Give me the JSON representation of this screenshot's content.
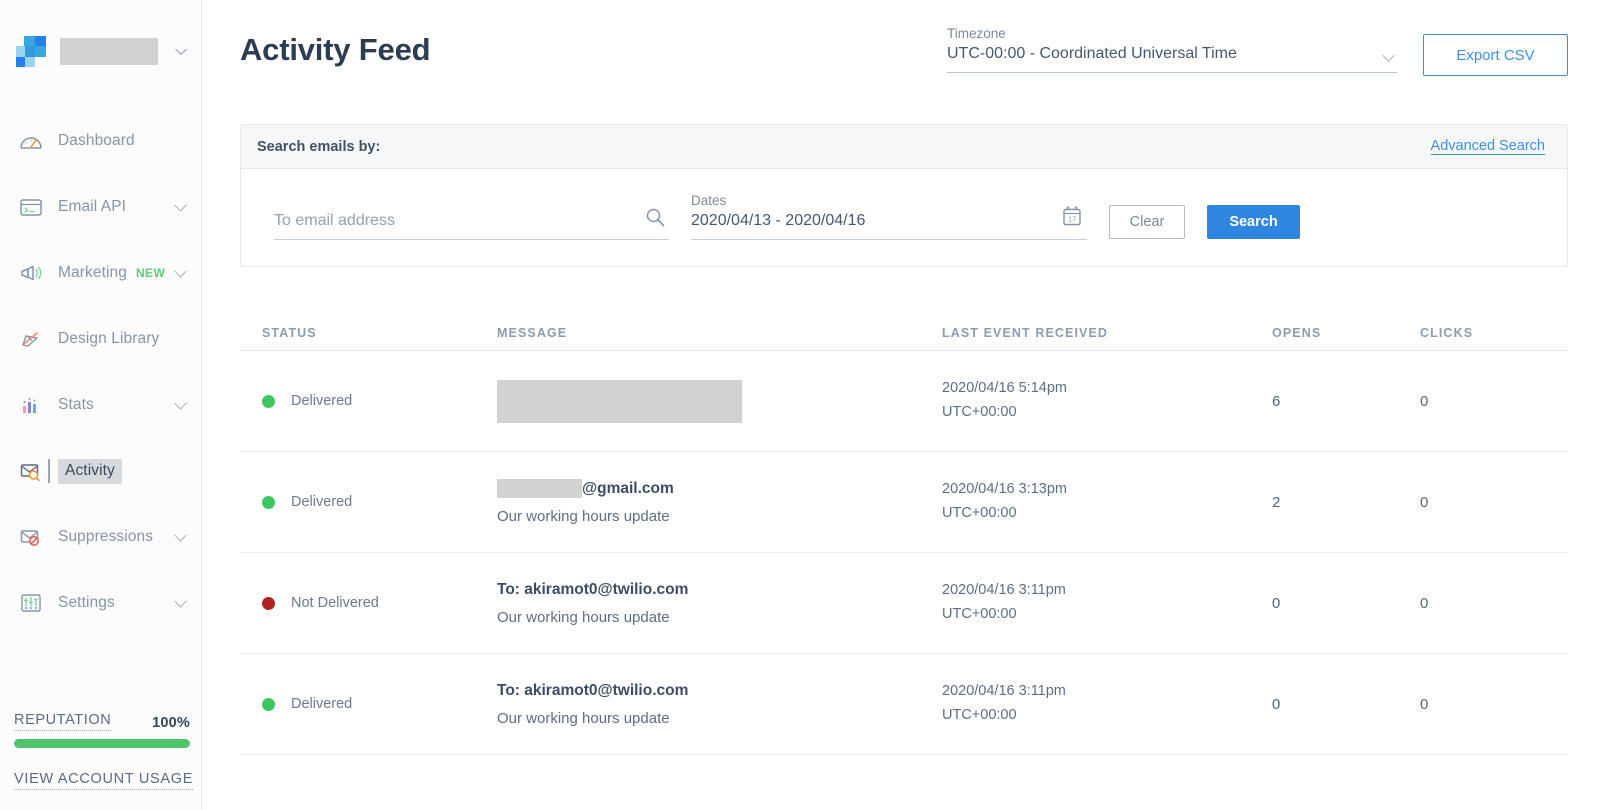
{
  "sidebar": {
    "account_redacted": true,
    "items": [
      {
        "label": "Dashboard",
        "icon": "gauge-icon",
        "caret": false,
        "active": false,
        "badge": null
      },
      {
        "label": "Email API",
        "icon": "terminal-icon",
        "caret": true,
        "active": false,
        "badge": null
      },
      {
        "label": "Marketing",
        "icon": "megaphone-icon",
        "caret": true,
        "active": false,
        "badge": "NEW"
      },
      {
        "label": "Design Library",
        "icon": "pencil-ruler-icon",
        "caret": false,
        "active": false,
        "badge": null
      },
      {
        "label": "Stats",
        "icon": "bar-chart-icon",
        "caret": true,
        "active": false,
        "badge": null
      },
      {
        "label": "Activity",
        "icon": "mail-search-icon",
        "caret": false,
        "active": true,
        "badge": null
      },
      {
        "label": "Suppressions",
        "icon": "mail-block-icon",
        "caret": true,
        "active": false,
        "badge": null
      },
      {
        "label": "Settings",
        "icon": "sliders-icon",
        "caret": true,
        "active": false,
        "badge": null
      }
    ],
    "reputation": {
      "label": "REPUTATION",
      "percent_label": "100%",
      "percent_value": 100,
      "bar_color": "#4fc46c"
    },
    "account_usage_link": "VIEW ACCOUNT USAGE"
  },
  "header": {
    "title": "Activity Feed",
    "timezone": {
      "label": "Timezone",
      "value": "UTC-00:00 - Coordinated Universal Time"
    },
    "export_button": "Export CSV"
  },
  "search_panel": {
    "title": "Search emails by:",
    "advanced_link": "Advanced Search",
    "to_field": {
      "placeholder": "To email address",
      "value": ""
    },
    "dates_field": {
      "label": "Dates",
      "value": "2020/04/13 - 2020/04/16",
      "calendar_day": "17"
    },
    "clear_button": "Clear",
    "search_button": "Search"
  },
  "table": {
    "columns": [
      "STATUS",
      "MESSAGE",
      "LAST EVENT RECEIVED",
      "OPENS",
      "CLICKS"
    ],
    "rows": [
      {
        "status": "Delivered",
        "status_color": "#3ec75f",
        "to_redacted": true,
        "to_redacted_width": 245,
        "to_redacted_height": 43,
        "to_prefix": "",
        "to_suffix": "",
        "subject": "",
        "last_event_date": "2020/04/16 5:14pm",
        "last_event_tz": "UTC+00:00",
        "opens": "6",
        "clicks": "0"
      },
      {
        "status": "Delivered",
        "status_color": "#3ec75f",
        "to_redacted": true,
        "to_redacted_width": 85,
        "to_redacted_height": 19,
        "to_prefix": "",
        "to_suffix": "@gmail.com",
        "subject": "Our working hours update",
        "last_event_date": "2020/04/16 3:13pm",
        "last_event_tz": "UTC+00:00",
        "opens": "2",
        "clicks": "0"
      },
      {
        "status": "Not Delivered",
        "status_color": "#b22222",
        "to_redacted": false,
        "to_redacted_width": 0,
        "to_redacted_height": 0,
        "to_prefix": "To: akiramot0@twilio.com",
        "to_suffix": "",
        "subject": "Our working hours update",
        "last_event_date": "2020/04/16 3:11pm",
        "last_event_tz": "UTC+00:00",
        "opens": "0",
        "clicks": "0"
      },
      {
        "status": "Delivered",
        "status_color": "#3ec75f",
        "to_redacted": false,
        "to_redacted_width": 0,
        "to_redacted_height": 0,
        "to_prefix": "To: akiramot0@twilio.com",
        "to_suffix": "",
        "subject": "Our working hours update",
        "last_event_date": "2020/04/16 3:11pm",
        "last_event_tz": "UTC+00:00",
        "opens": "0",
        "clicks": "0"
      }
    ]
  },
  "colors": {
    "accent_blue": "#2f86e0",
    "link_blue": "#3f8fe0",
    "title_navy": "#2b3c53",
    "green": "#4fc46c"
  }
}
